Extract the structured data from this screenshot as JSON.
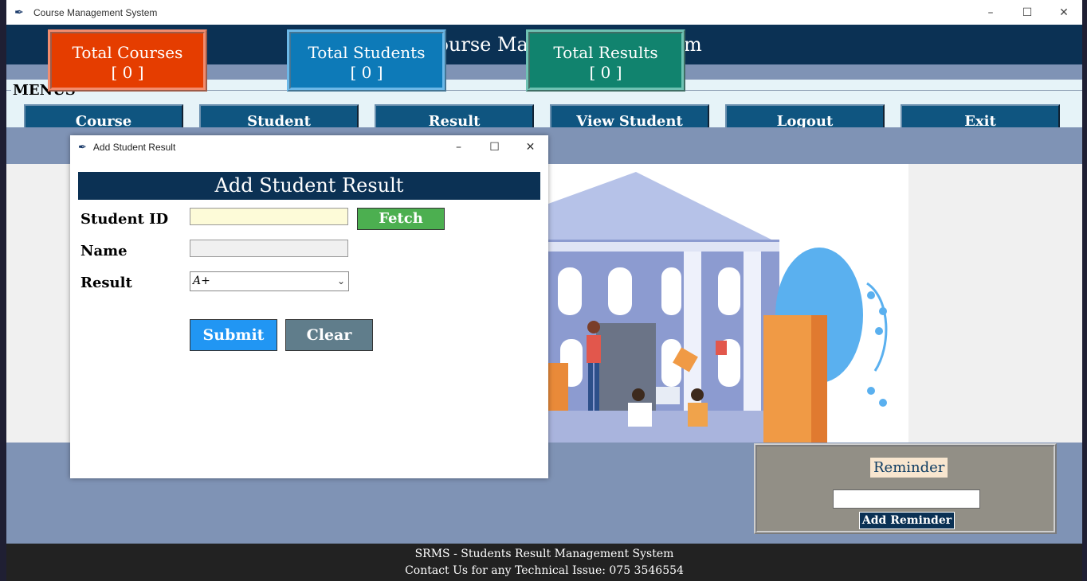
{
  "window": {
    "title": "Course Management System",
    "minimize_glyph": "–",
    "maximize_glyph": "☐",
    "close_glyph": "✕"
  },
  "header": {
    "icon": "books-icon",
    "title": "Course Management System"
  },
  "menus": {
    "label": "MENUS",
    "items": [
      {
        "label": "Course"
      },
      {
        "label": "Student"
      },
      {
        "label": "Result"
      },
      {
        "label": "View Student Results"
      },
      {
        "label": "Logout"
      },
      {
        "label": "Exit"
      }
    ]
  },
  "stats": [
    {
      "title": "Total Courses",
      "value": "[ 0 ]",
      "color": "#e53d00",
      "border": "#f28c6e"
    },
    {
      "title": "Total Students",
      "value": "[ 0 ]",
      "color": "#0d7ab8",
      "border": "#6bb8e8"
    },
    {
      "title": "Total Results",
      "value": "[ 0 ]",
      "color": "#11836e",
      "border": "#6fc2b3"
    }
  ],
  "reminder": {
    "title": "Reminder",
    "input_value": "",
    "button_label": "Add Reminder"
  },
  "footer": {
    "line1": "SRMS - Students Result Management System",
    "line2": "Contact Us for any Technical Issue: 075 3546554"
  },
  "dialog": {
    "title": "Add Student Result",
    "heading": "Add Student Result",
    "student_id_label": "Student ID",
    "student_id_value": "",
    "fetch_button": "Fetch Name",
    "name_label": "Name",
    "name_value": "",
    "result_label": "Result",
    "result_selected": "A+",
    "submit_button": "Submit",
    "clear_button": "Clear"
  },
  "colors": {
    "header_bg": "#0b3154",
    "menu_btn_bg": "#0f5580",
    "fetch_btn_bg": "#4caf50",
    "submit_btn_bg": "#2196f3",
    "clear_btn_bg": "#607d8b"
  }
}
